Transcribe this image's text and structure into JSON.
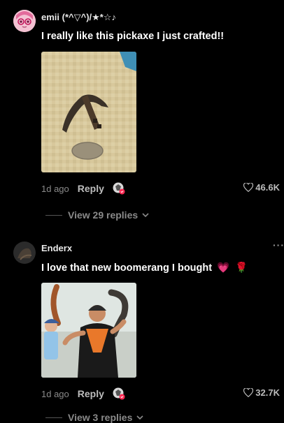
{
  "comments": [
    {
      "username": "emii (*^▽^)/★*☆♪",
      "text": "I really like this pickaxe I just crafted!!",
      "time": "1d ago",
      "reply_label": "Reply",
      "likes": "46.6K",
      "view_replies": "View 29 replies"
    },
    {
      "username": "Enderx",
      "text": "I love that new boomerang I bought",
      "text_emojis": [
        "💗",
        "🌹"
      ],
      "time": "1d ago",
      "reply_label": "Reply",
      "likes": "32.7K",
      "view_replies": "View 3 replies",
      "more_label": "···"
    }
  ],
  "colors": {
    "background": "#000000",
    "secondary_text": "#8a8a8a",
    "like_badge": "#fe2c55"
  }
}
